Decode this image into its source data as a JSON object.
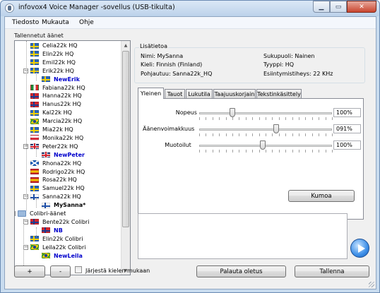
{
  "window": {
    "title": "infovox4 Voice Manager -sovellus (USB-tikulta)"
  },
  "menu": [
    "Tiedosto",
    "Mukauta",
    "Ohje"
  ],
  "tree_label": "Tallennetut äänet",
  "tree": [
    {
      "label": "Celia22k HQ",
      "flag": "se"
    },
    {
      "label": "Elin22k HQ",
      "flag": "se"
    },
    {
      "label": "Emil22k HQ",
      "flag": "se"
    },
    {
      "label": "Erik22k HQ",
      "flag": "se",
      "expanded": true
    },
    {
      "label": "NewErik",
      "flag": "se",
      "child": true
    },
    {
      "label": "Fabiana22k HQ",
      "flag": "it"
    },
    {
      "label": "Hanna22k HQ",
      "flag": "no"
    },
    {
      "label": "Hanus22k HQ",
      "flag": "no"
    },
    {
      "label": "Kal22k HQ",
      "flag": "se"
    },
    {
      "label": "Marcia22k HQ",
      "flag": "br"
    },
    {
      "label": "Mia22k HQ",
      "flag": "se"
    },
    {
      "label": "Monika22k HQ",
      "flag": "pl"
    },
    {
      "label": "Peter22k HQ",
      "flag": "gb",
      "expanded": true
    },
    {
      "label": "NewPeter",
      "flag": "gb",
      "child": true
    },
    {
      "label": "Rhona22k HQ",
      "flag": "sc"
    },
    {
      "label": "Rodrigo22k HQ",
      "flag": "es"
    },
    {
      "label": "Rosa22k HQ",
      "flag": "es"
    },
    {
      "label": "Samuel22k HQ",
      "flag": "se"
    },
    {
      "label": "Sanna22k HQ",
      "flag": "fi",
      "expanded": true
    },
    {
      "label": "MySanna*",
      "flag": "fi",
      "child": true,
      "dark": true
    },
    {
      "label": "Colibri-äänet",
      "flag": "folder",
      "expanded": true,
      "root": true
    },
    {
      "label": "Bente22k Colibri",
      "flag": "no",
      "expanded": true
    },
    {
      "label": "NB",
      "flag": "no",
      "child": true
    },
    {
      "label": "Elin22k Colibri",
      "flag": "se"
    },
    {
      "label": "Leila22k Colibri",
      "flag": "br",
      "expanded": true
    },
    {
      "label": "NewLeila",
      "flag": "br",
      "child": true
    }
  ],
  "left_buttons": {
    "add": "+",
    "remove": "-"
  },
  "sort_checkbox": "Järjestä kielen mukaan",
  "info": {
    "group_label": "Lisätietoa",
    "name": "Nimi: MySanna",
    "language": "Kieli: Finnish (Finland)",
    "base": "Pohjautuu: Sanna22k_HQ",
    "gender": "Sukupuoli: Nainen",
    "type": "Tyyppi: HQ",
    "rate": "Esiintymistiheys: 22 KHz"
  },
  "tabs": [
    "Yleinen",
    "Tauot",
    "Lukutila",
    "Taajuuskorjain",
    "Tekstinkäsittely"
  ],
  "sliders": [
    {
      "label": "Nopeus",
      "value": "100%",
      "level": 0.25
    },
    {
      "label": "Äänenvoimakkuus",
      "value": "091%",
      "level": 0.58
    },
    {
      "label": "Muotoilut",
      "value": "100%",
      "level": 0.48
    }
  ],
  "undo_button": "Kumoa",
  "restore_button": "Palauta oletus",
  "save_button": "Tallenna",
  "colors": {
    "subvoice": "#0000cc",
    "accent": "#3d8fe8"
  }
}
